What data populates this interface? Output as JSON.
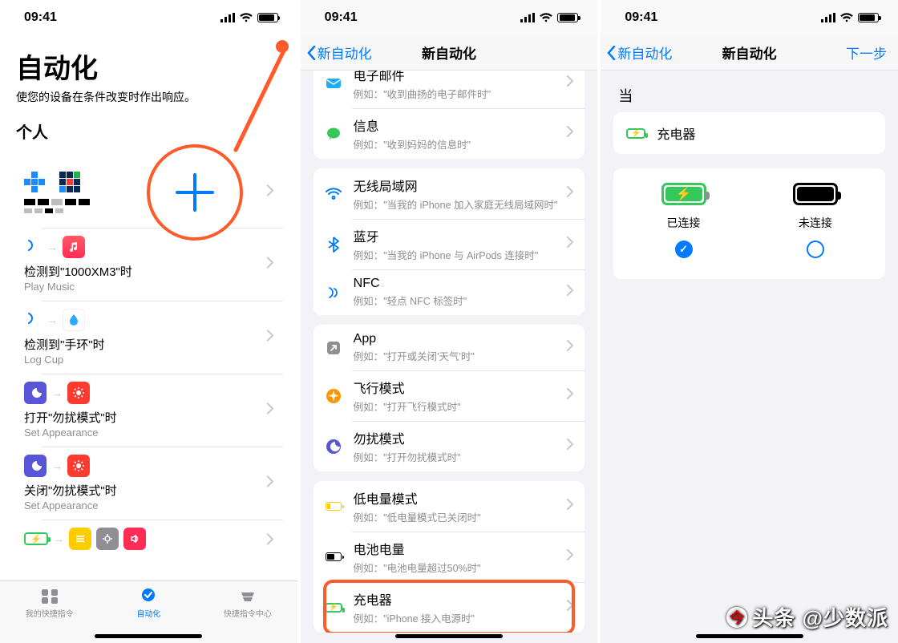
{
  "statusbar": {
    "time": "09:41"
  },
  "screen1": {
    "title": "自动化",
    "subtitle": "使您的设备在条件改变时作出响应。",
    "section": "个人",
    "tabs": {
      "shortcuts": "我的快捷指令",
      "automation": "自动化",
      "gallery": "快捷指令中心"
    },
    "items": [
      {
        "title": "检测到\"1000XM3\"时",
        "sub": "Play Music"
      },
      {
        "title": "检测到\"手环\"时",
        "sub": "Log Cup"
      },
      {
        "title": "打开\"勿扰模式\"时",
        "sub": "Set Appearance"
      },
      {
        "title": "关闭\"勿扰模式\"时",
        "sub": "Set Appearance"
      }
    ]
  },
  "screen2": {
    "back": "新自动化",
    "title": "新自动化",
    "prefix": "例如：",
    "rows": {
      "email": {
        "t": "电子邮件",
        "ex": "\"收到曲扬的电子邮件时\""
      },
      "message": {
        "t": "信息",
        "ex": "\"收到妈妈的信息时\""
      },
      "wifi": {
        "t": "无线局域网",
        "ex": "\"当我的 iPhone 加入家庭无线局域网时\""
      },
      "bluetooth": {
        "t": "蓝牙",
        "ex": "\"当我的 iPhone 与 AirPods 连接时\""
      },
      "nfc": {
        "t": "NFC",
        "ex": "\"轻点 NFC 标签时\""
      },
      "app": {
        "t": "App",
        "ex": "\"打开或关闭'天气'时\""
      },
      "airplane": {
        "t": "飞行模式",
        "ex": "\"打开飞行模式时\""
      },
      "dnd": {
        "t": "勿扰模式",
        "ex": "\"打开勿扰模式时\""
      },
      "lowpower": {
        "t": "低电量模式",
        "ex": "\"低电量模式已关闭时\""
      },
      "battery": {
        "t": "电池电量",
        "ex": "\"电池电量超过50%时\""
      },
      "charger": {
        "t": "充电器",
        "ex": "\"iPhone 接入电源时\""
      }
    }
  },
  "screen3": {
    "back": "新自动化",
    "title": "新自动化",
    "next": "下一步",
    "when": "当",
    "charger": "充电器",
    "connected": "已连接",
    "disconnected": "未连接"
  },
  "watermark": "头条 @少数派"
}
